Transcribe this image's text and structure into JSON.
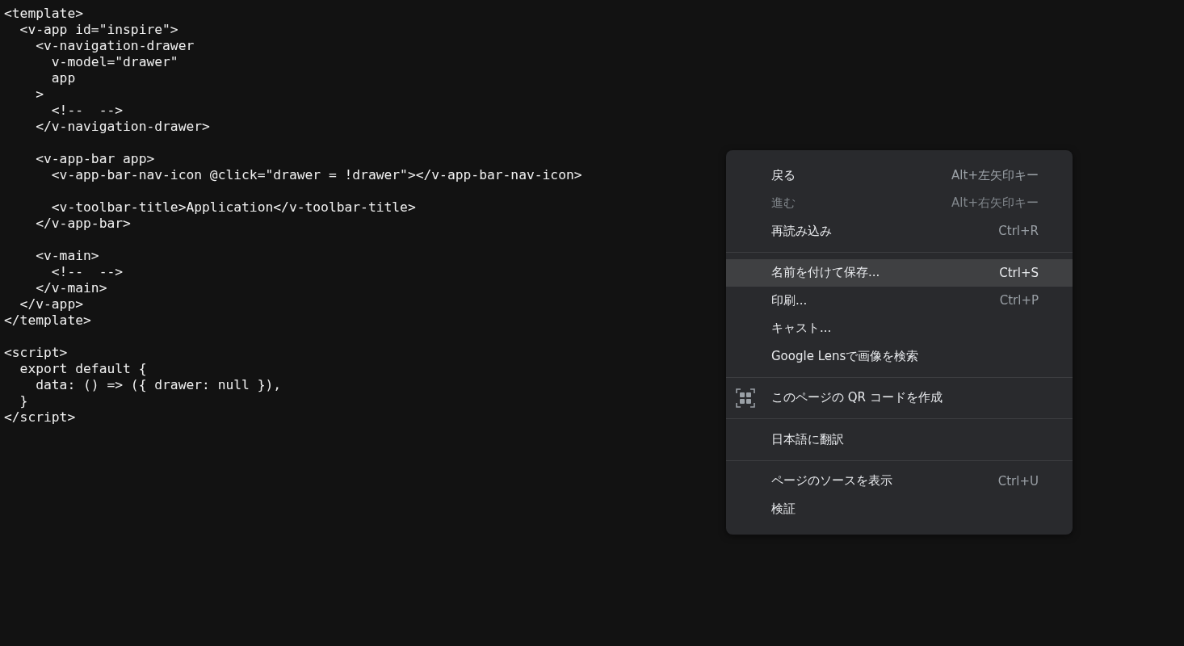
{
  "code": {
    "blocks": [
      [
        "<template>",
        "  <v-app id=\"inspire\">",
        "    <v-navigation-drawer",
        "      v-model=\"drawer\"",
        "      app",
        "    >",
        "      <!--  -->",
        "    </v-navigation-drawer>"
      ],
      [
        "    <v-app-bar app>",
        "      <v-app-bar-nav-icon @click=\"drawer = !drawer\"></v-app-bar-nav-icon>"
      ],
      [
        "      <v-toolbar-title>Application</v-toolbar-title>",
        "    </v-app-bar>"
      ],
      [
        "    <v-main>",
        "      <!--  -->",
        "    </v-main>",
        "  </v-app>",
        "</template>"
      ],
      [
        "<script>",
        "  export default {",
        "    data: () => ({ drawer: null }),",
        "  }",
        "</script>"
      ]
    ]
  },
  "context_menu": {
    "sections": [
      [
        {
          "kind": "text",
          "label": "戻る",
          "shortcut": "Alt+左矢印キー",
          "disabled": false,
          "selected": false
        },
        {
          "kind": "text",
          "label": "進む",
          "shortcut": "Alt+右矢印キー",
          "disabled": true,
          "selected": false
        },
        {
          "kind": "text",
          "label": "再読み込み",
          "shortcut": "Ctrl+R",
          "disabled": false,
          "selected": false
        }
      ],
      [
        {
          "kind": "text",
          "label": "名前を付けて保存...",
          "shortcut": "Ctrl+S",
          "disabled": false,
          "selected": true
        },
        {
          "kind": "text",
          "label": "印刷...",
          "shortcut": "Ctrl+P",
          "disabled": false,
          "selected": false
        },
        {
          "kind": "text",
          "label": "キャスト...",
          "disabled": false,
          "selected": false
        },
        {
          "kind": "text",
          "label": "Google Lensで画像を検索",
          "disabled": false,
          "selected": false
        }
      ],
      [
        {
          "kind": "icon",
          "label": "このページの QR コードを作成",
          "disabled": false,
          "selected": false
        }
      ],
      [
        {
          "kind": "text",
          "label": "日本語に翻訳",
          "disabled": false,
          "selected": false
        }
      ],
      [
        {
          "kind": "text",
          "label": "ページのソースを表示",
          "shortcut": "Ctrl+U",
          "disabled": false,
          "selected": false
        },
        {
          "kind": "text",
          "label": "検証",
          "disabled": false,
          "selected": false
        }
      ]
    ]
  }
}
